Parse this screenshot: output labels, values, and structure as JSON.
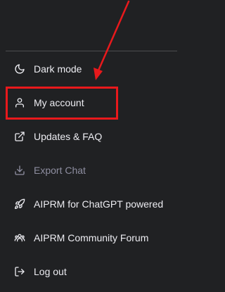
{
  "menu": {
    "items": [
      {
        "label": "Dark mode",
        "icon": "moon-icon",
        "enabled": true
      },
      {
        "label": "My account",
        "icon": "user-icon",
        "enabled": true
      },
      {
        "label": "Updates & FAQ",
        "icon": "external-link-icon",
        "enabled": true
      },
      {
        "label": "Export Chat",
        "icon": "download-icon",
        "enabled": false
      },
      {
        "label": "AIPRM for ChatGPT powered",
        "icon": "rocket-icon",
        "enabled": true
      },
      {
        "label": "AIPRM Community Forum",
        "icon": "community-icon",
        "enabled": true
      },
      {
        "label": "Log out",
        "icon": "logout-icon",
        "enabled": true
      }
    ]
  },
  "annotation": {
    "highlight_color": "#e8191c",
    "highlighted_item": "My account"
  },
  "colors": {
    "background": "#202123",
    "text": "#ececf1",
    "disabled_text": "#8e8ea0",
    "divider": "#4d4d4f"
  }
}
